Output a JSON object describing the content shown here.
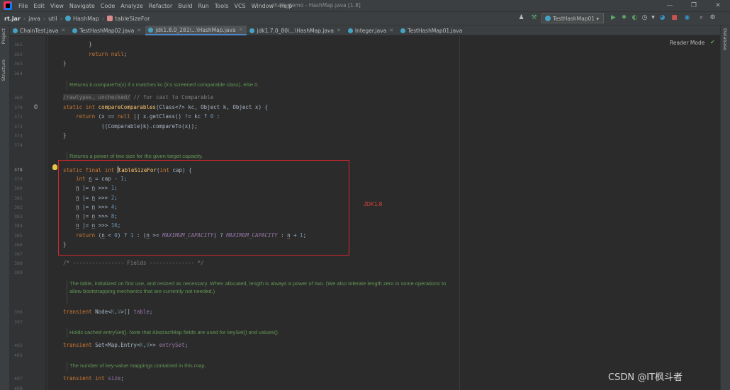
{
  "menubar": {
    "items": [
      "File",
      "Edit",
      "View",
      "Navigate",
      "Code",
      "Analyze",
      "Refactor",
      "Build",
      "Run",
      "Tools",
      "VCS",
      "Window",
      "Help"
    ],
    "title": "chain_demo - HashMap.java [1.8]",
    "minimize": "—",
    "restore": "❐",
    "close": "✕"
  },
  "navbar": {
    "crumbs": [
      "rt.jar",
      "java",
      "util",
      "HashMap",
      "tableSizeFor"
    ],
    "run_config": "TestHashMap01 ▾"
  },
  "left_strip": {
    "project": "Project",
    "structure": "Structure"
  },
  "right_strip": {
    "database": "Database"
  },
  "tabs": [
    {
      "label": "ChainTest.java"
    },
    {
      "label": "TestHashMap02.java"
    },
    {
      "label": "jdk1.8.0_281\\...\\HashMap.java"
    },
    {
      "label": "jdk1.7.0_80\\...\\HashMap.java"
    },
    {
      "label": "Integer.java"
    },
    {
      "label": "TestHashMap01.java"
    }
  ],
  "editor": {
    "reader_mode": "Reader Mode",
    "line_numbers": {
      "l361": "361",
      "l362": "362",
      "l363": "363",
      "l364": "364",
      "l369": "369",
      "l370": "370",
      "l371": "371",
      "l372": "372",
      "l373": "373",
      "l374": "374",
      "l378": "378",
      "l379": "379",
      "l380": "380",
      "l381": "381",
      "l382": "382",
      "l383": "383",
      "l384": "384",
      "l385": "385",
      "l386": "386",
      "l387": "387",
      "l388": "388",
      "l389": "389",
      "l396": "396",
      "l397": "397",
      "l402": "402",
      "l403": "403",
      "l407": "407",
      "l408": "408"
    },
    "docs": {
      "compare": "Returns k.compareTo(x) if x matches kc (k's screened comparable class), else 0.",
      "tablesize": "Returns a power of two size for the given target capacity.",
      "table": "The table, initialized on first use, and resized as necessary. When allocated, length is always a power of two. (We also tolerate length zero in some operations to allow bootstrapping mechanics that are currently not needed.)",
      "entryset": "Holds cached entrySet(). Note that AbstractMap fields are used for keySet() and values().",
      "size": "The number of key-value mappings contained in this map."
    },
    "annotation_label": "JDK1.8",
    "gutter_marker": "@"
  },
  "watermark": "CSDN @IT枫斗者"
}
